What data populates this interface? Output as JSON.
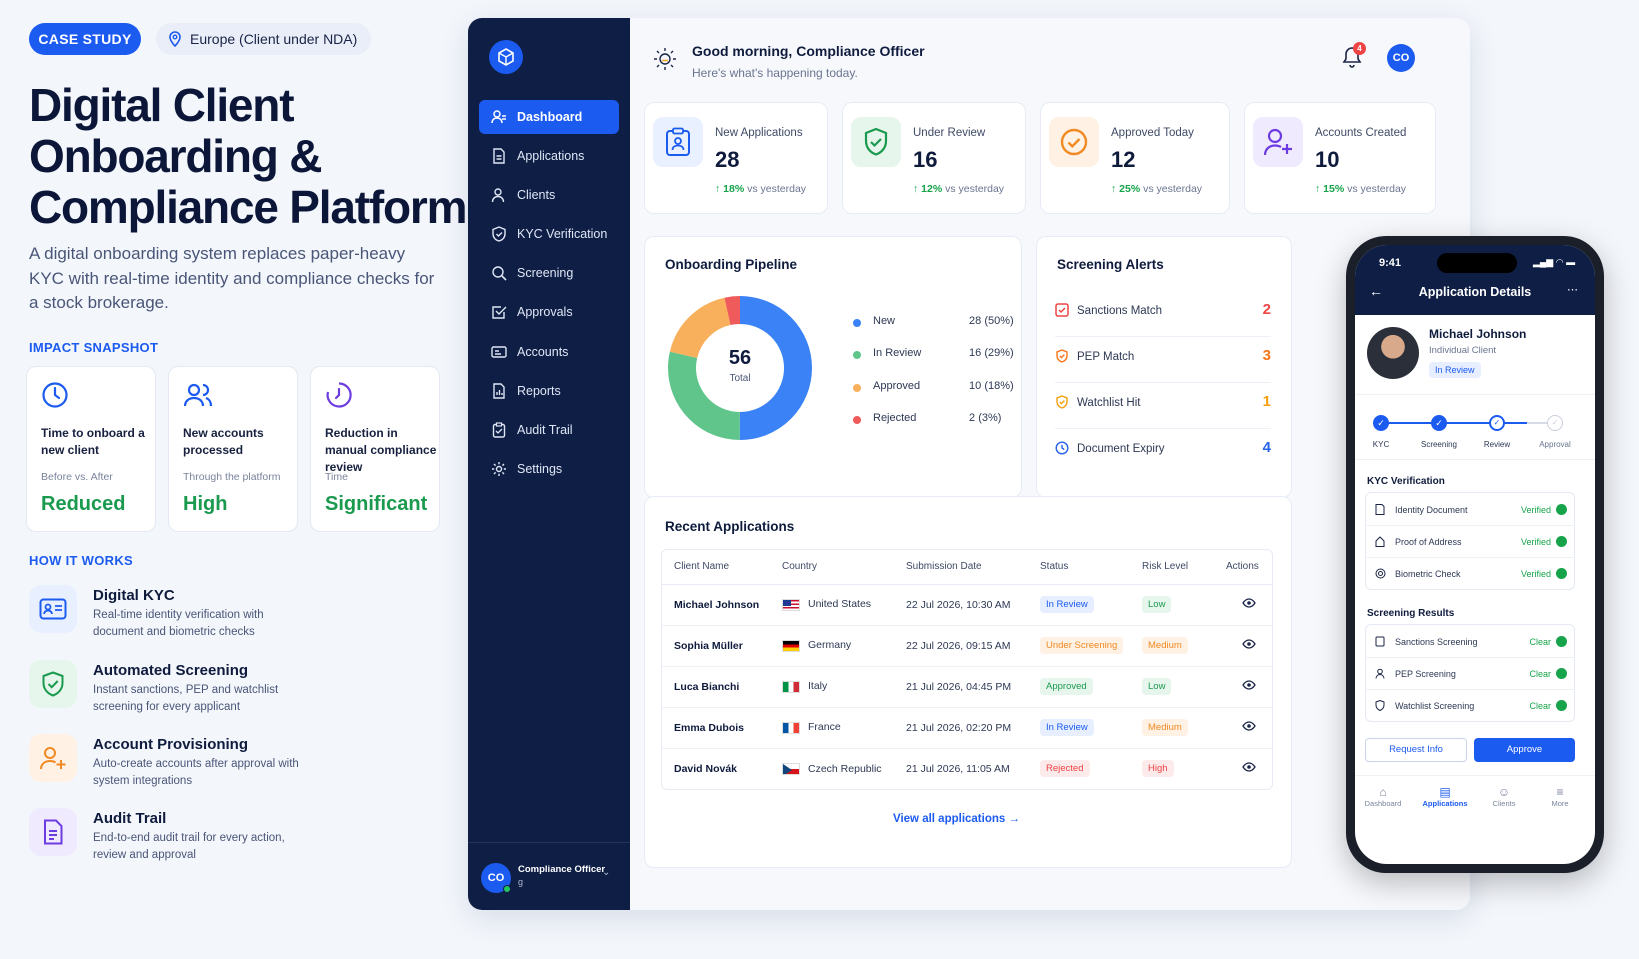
{
  "header": {
    "badge": "CASE STUDY",
    "location": "Europe (Client under NDA)"
  },
  "title_lines": [
    "Digital Client",
    "Onboarding &",
    "Compliance Platform"
  ],
  "subtitle": "A digital onboarding system replaces paper-heavy KYC with real-time identity and compliance checks for a stock brokerage.",
  "impact": {
    "heading": "IMPACT SNAPSHOT",
    "cards": [
      {
        "label": "Time to onboard a new client",
        "note": "Before vs. After",
        "value": "Reduced",
        "icon": "clock-icon"
      },
      {
        "label": "New accounts processed",
        "note": "Through the platform",
        "value": "High",
        "icon": "users-icon"
      },
      {
        "label": "Reduction in manual compliance review",
        "note": "Time",
        "value": "Significant",
        "icon": "history-icon"
      }
    ]
  },
  "how": {
    "heading": "HOW IT WORKS",
    "items": [
      {
        "title": "Digital KYC",
        "desc": "Real-time identity verification with document and biometric checks",
        "icon": "id-card-icon"
      },
      {
        "title": "Automated Screening",
        "desc": "Instant sanctions, PEP and watchlist screening for every applicant",
        "icon": "shield-icon"
      },
      {
        "title": "Account Provisioning",
        "desc": "Auto-create accounts after approval with system integrations",
        "icon": "user-plus-icon"
      },
      {
        "title": "Audit Trail",
        "desc": "End-to-end audit trail for every action, review and approval",
        "icon": "document-icon"
      }
    ]
  },
  "sidebar": {
    "items": [
      {
        "label": "Dashboard",
        "icon": "dashboard-icon"
      },
      {
        "label": "Applications",
        "icon": "file-icon"
      },
      {
        "label": "Clients",
        "icon": "user-icon"
      },
      {
        "label": "KYC Verification",
        "icon": "shield-check-icon"
      },
      {
        "label": "Screening",
        "icon": "search-icon"
      },
      {
        "label": "Approvals",
        "icon": "check-square-icon"
      },
      {
        "label": "Accounts",
        "icon": "id-icon"
      },
      {
        "label": "Reports",
        "icon": "report-icon"
      },
      {
        "label": "Audit Trail",
        "icon": "clipboard-icon"
      },
      {
        "label": "Settings",
        "icon": "gear-icon"
      }
    ],
    "user_initials": "CO",
    "user_name": "Compliance Officer",
    "user_role": "g"
  },
  "topbar": {
    "greeting": "Good morning, Compliance Officer",
    "subtext": "Here's what's happening today.",
    "notification_count": "4",
    "avatar": "CO"
  },
  "stats": [
    {
      "label": "New Applications",
      "value": "28",
      "delta": "18%",
      "delta_text": "vs yesterday"
    },
    {
      "label": "Under Review",
      "value": "16",
      "delta": "12%",
      "delta_text": "vs yesterday"
    },
    {
      "label": "Approved Today",
      "value": "12",
      "delta": "25%",
      "delta_text": "vs yesterday"
    },
    {
      "label": "Accounts Created",
      "value": "10",
      "delta": "15%",
      "delta_text": "vs yesterday"
    }
  ],
  "pipeline": {
    "title": "Onboarding Pipeline",
    "total": "56",
    "total_label": "Total",
    "legend": [
      {
        "name": "New",
        "value": "28",
        "pct": "(50%)",
        "count": 28,
        "color": "#3b82f6"
      },
      {
        "name": "In Review",
        "value": "16",
        "pct": "(29%)",
        "count": 16,
        "color": "#60c58a"
      },
      {
        "name": "Approved",
        "value": "10",
        "pct": "(18%)",
        "count": 10,
        "color": "#f8b05c"
      },
      {
        "name": "Rejected",
        "value": "2",
        "pct": "(3%)",
        "count": 2,
        "color": "#ef5a5a"
      }
    ]
  },
  "alerts": {
    "title": "Screening Alerts",
    "items": [
      {
        "name": "Sanctions Match",
        "count": "2",
        "color": "#ef4444"
      },
      {
        "name": "PEP Match",
        "count": "3",
        "color": "#f97316"
      },
      {
        "name": "Watchlist Hit",
        "count": "1",
        "color": "#f59e0b"
      },
      {
        "name": "Document Expiry",
        "count": "4",
        "color": "#2563eb"
      }
    ]
  },
  "recent": {
    "title": "Recent Applications",
    "columns": [
      "Client Name",
      "Country",
      "Submission Date",
      "Status",
      "Risk Level",
      "Actions"
    ],
    "rows": [
      {
        "name": "Michael Johnson",
        "country": "United States",
        "date": "22 Jul 2026, 10:30 AM",
        "status": "In Review",
        "risk": "Low"
      },
      {
        "name": "Sophia Müller",
        "country": "Germany",
        "date": "22 Jul 2026, 09:15 AM",
        "status": "Under Screening",
        "risk": "Medium"
      },
      {
        "name": "Luca Bianchi",
        "country": "Italy",
        "date": "21 Jul 2026, 04:45 PM",
        "status": "Approved",
        "risk": "Low"
      },
      {
        "name": "Emma Dubois",
        "country": "France",
        "date": "21 Jul 2026, 02:20 PM",
        "status": "In Review",
        "risk": "Medium"
      },
      {
        "name": "David Novák",
        "country": "Czech Republic",
        "date": "21 Jul 2026, 11:05 AM",
        "status": "Rejected",
        "risk": "High"
      }
    ],
    "view_all": "View all applications"
  },
  "phone": {
    "time": "9:41",
    "title": "Application Details",
    "client_name": "Michael Johnson",
    "client_type": "Individual Client",
    "status": "In Review",
    "steps": [
      "KYC",
      "Screening",
      "Review",
      "Approval"
    ],
    "kyc_title": "KYC Verification",
    "kyc": [
      {
        "name": "Identity Document",
        "status": "Verified"
      },
      {
        "name": "Proof of Address",
        "status": "Verified"
      },
      {
        "name": "Biometric Check",
        "status": "Verified"
      }
    ],
    "screen_title": "Screening Results",
    "screening": [
      {
        "name": "Sanctions Screening",
        "status": "Clear"
      },
      {
        "name": "PEP Screening",
        "status": "Clear"
      },
      {
        "name": "Watchlist Screening",
        "status": "Clear"
      }
    ],
    "request_info": "Request Info",
    "approve": "Approve",
    "tabs": [
      "Dashboard",
      "Applications",
      "Clients",
      "More"
    ]
  }
}
